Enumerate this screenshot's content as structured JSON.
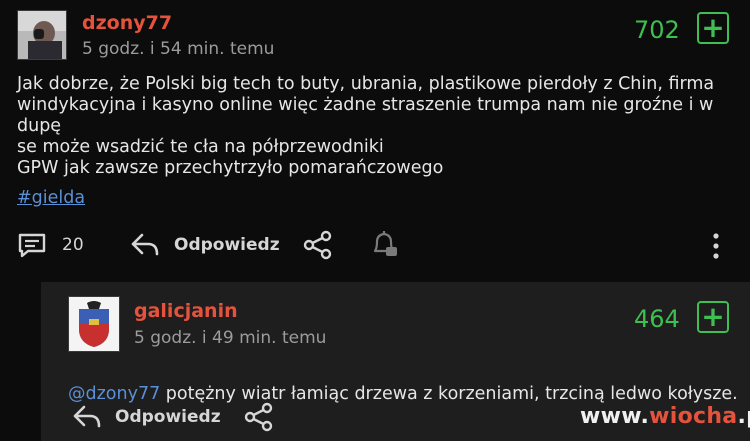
{
  "post": {
    "author": "dzony77",
    "time": "5 godz. i 54 min. temu",
    "score": "702",
    "vote_symbol": "+",
    "body": "Jak dobrze, że Polski big tech to buty, ubrania, plastikowe pierdoły z Chin, firma\nwindykacyjna i kasyno online więc żadne straszenie trumpa nam nie groźne i w dupę\nse może wsadzić te cła na półprzewodniki\nGPW jak zawsze przechytrzyło pomarańczowego",
    "tag": "#gielda",
    "comments_count": "20",
    "reply_label": "Odpowiedz"
  },
  "reply": {
    "author": "galicjanin",
    "time": "5 godz. i 49 min. temu",
    "score": "464",
    "vote_symbol": "+",
    "mention": "@dzony77",
    "text": " potężny wiatr łamiąc drzewa z korzeniami, trzciną ledwo kołysze.",
    "reply_label": "Odpowiedz"
  },
  "watermark": {
    "prefix": "www.",
    "accent": "wiocha",
    "suffix": ".pl"
  },
  "icons": {
    "comments": "comment-bubble-icon",
    "reply": "reply-arrow-icon",
    "share": "share-icon",
    "notify": "bell-icon",
    "more": "vertical-dots-icon"
  },
  "colors": {
    "background": "#0c0c0c",
    "reply_background": "#1e1e1e",
    "username": "#e5533d",
    "score": "#3fbf52",
    "link": "#5b8fd6"
  }
}
